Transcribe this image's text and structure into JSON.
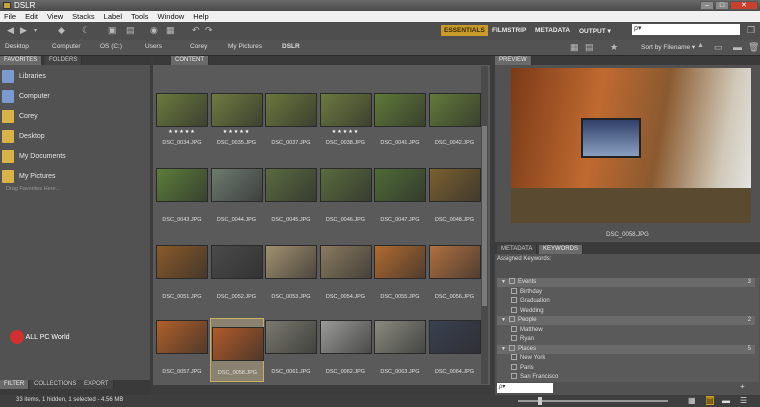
{
  "window": {
    "title": "DSLR",
    "minimize": "–",
    "maximize": "□",
    "close": "✕"
  },
  "menu": [
    "File",
    "Edit",
    "View",
    "Stacks",
    "Label",
    "Tools",
    "Window",
    "Help"
  ],
  "workspaces": {
    "essentials": "ESSENTIALS",
    "filmstrip": "FILMSTRIP",
    "metadata": "METADATA",
    "output": "OUTPUT ▾"
  },
  "search": {
    "placeholder": "ρ▾"
  },
  "sort": {
    "label": "Sort by Filename ▾"
  },
  "breadcrumb": [
    "Desktop",
    "Computer",
    "OS (C:)",
    "Users",
    "Corey",
    "My Pictures",
    "DSLR"
  ],
  "left_panel": {
    "tabs": [
      "FAVORITES",
      "FOLDERS"
    ],
    "items": [
      {
        "label": "Libraries",
        "icon": "libraries-icon"
      },
      {
        "label": "Computer",
        "icon": "computer-icon"
      },
      {
        "label": "Corey",
        "icon": "folder-icon"
      },
      {
        "label": "Desktop",
        "icon": "folder-icon"
      },
      {
        "label": "My Documents",
        "icon": "documents-icon"
      },
      {
        "label": "My Pictures",
        "icon": "pictures-icon"
      }
    ],
    "drag_hint": "Drag Favorites Here...",
    "bottom_tabs": [
      "FILTER",
      "COLLECTIONS",
      "EXPORT"
    ]
  },
  "content": {
    "tab": "CONTENT",
    "rows": [
      [
        {
          "name": "DSC_0034.JPG",
          "stars": "★★★★★",
          "tone": "#6b7a3e"
        },
        {
          "name": "DSC_0035.JPG",
          "stars": "★★★★★",
          "tone": "#6e7b40"
        },
        {
          "name": "DSC_0037.JPG",
          "stars": "",
          "tone": "#6a783c"
        },
        {
          "name": "DSC_0038.JPG",
          "stars": "★★★★★",
          "tone": "#6c7a3f"
        },
        {
          "name": "DSC_0041.JPG",
          "stars": "",
          "tone": "#5f7a38"
        },
        {
          "name": "DSC_0042.JPG",
          "stars": "",
          "tone": "#627a3a"
        }
      ],
      [
        {
          "name": "DSC_0043.JPG",
          "stars": "",
          "tone": "#5c7d3a"
        },
        {
          "name": "DSC_0044.JPG",
          "stars": "",
          "tone": "#6e7a70"
        },
        {
          "name": "DSC_0045.JPG",
          "stars": "",
          "tone": "#5a6a40"
        },
        {
          "name": "DSC_0046.JPG",
          "stars": "",
          "tone": "#5a6b3e"
        },
        {
          "name": "DSC_0047.JPG",
          "stars": "",
          "tone": "#4e6a36"
        },
        {
          "name": "DSC_0048.JPG",
          "stars": "",
          "tone": "#7a6030"
        }
      ],
      [
        {
          "name": "DSC_0051.JPG",
          "stars": "",
          "tone": "#8a5a2a"
        },
        {
          "name": "DSC_0052.JPG",
          "stars": "",
          "tone": "#4a4a4a"
        },
        {
          "name": "DSC_0053.JPG",
          "stars": "",
          "tone": "#a09070"
        },
        {
          "name": "DSC_0054.JPG",
          "stars": "",
          "tone": "#8a7a60"
        },
        {
          "name": "DSC_0055.JPG",
          "stars": "",
          "tone": "#b06a30"
        },
        {
          "name": "DSC_0056.JPG",
          "stars": "",
          "tone": "#b07040"
        }
      ],
      [
        {
          "name": "DSC_0057.JPG",
          "stars": "",
          "tone": "#b0602a"
        },
        {
          "name": "DSC_0058.JPG",
          "stars": "",
          "tone": "#b05a2a",
          "selected": true
        },
        {
          "name": "DSC_0061.JPG",
          "stars": "",
          "tone": "#7a7a70"
        },
        {
          "name": "DSC_0062.JPG",
          "stars": "",
          "tone": "#9a9a98"
        },
        {
          "name": "DSC_0063.JPG",
          "stars": "",
          "tone": "#8a8a80"
        },
        {
          "name": "DSC_0064.JPG",
          "stars": "",
          "tone": "#3a4050"
        }
      ]
    ]
  },
  "preview": {
    "tab": "PREVIEW",
    "caption": "DSC_0058.JPG"
  },
  "keywords": {
    "tabs": [
      "METADATA",
      "KEYWORDS"
    ],
    "assigned_label": "Assigned Keywords:",
    "items": [
      {
        "label": "Events",
        "cat": true,
        "count": "3"
      },
      {
        "label": "Birthday"
      },
      {
        "label": "Graduation"
      },
      {
        "label": "Wedding"
      },
      {
        "label": "People",
        "cat": true,
        "count": "2"
      },
      {
        "label": "Matthew"
      },
      {
        "label": "Ryan"
      },
      {
        "label": "Places",
        "cat": true,
        "count": "5"
      },
      {
        "label": "New York"
      },
      {
        "label": "Paris"
      },
      {
        "label": "San Francisco"
      }
    ],
    "search_placeholder": "ρ▾"
  },
  "status": {
    "text": "33 items, 1 hidden, 1 selected - 4.56 MB"
  },
  "watermark": "ALL PC World"
}
